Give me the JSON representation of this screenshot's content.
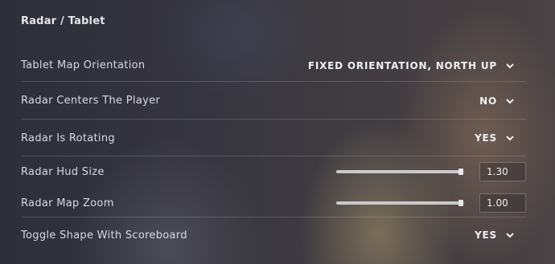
{
  "section": {
    "title": "Radar / Tablet"
  },
  "rows": [
    {
      "label": "Tablet Map Orientation",
      "value": "FIXED ORIENTATION, NORTH UP",
      "icon": "chevron-down-icon"
    },
    {
      "label": "Radar Centers The Player",
      "value": "NO",
      "icon": "chevron-down-icon"
    },
    {
      "label": "Radar Is Rotating",
      "value": "YES",
      "icon": "chevron-down-icon"
    },
    {
      "label": "Radar Hud Size",
      "value": "1.30",
      "slider_fraction": 0.97
    },
    {
      "label": "Radar Map Zoom",
      "value": "1.00",
      "slider_fraction": 0.97
    },
    {
      "label": "Toggle Shape With Scoreboard",
      "value": "YES",
      "icon": "chevron-down-icon"
    }
  ],
  "colors": {
    "text": "#d8dade",
    "value_text": "#eef0f2",
    "divider": "rgba(200,200,210,0.22)",
    "slider_fill": "#c9cacd"
  }
}
